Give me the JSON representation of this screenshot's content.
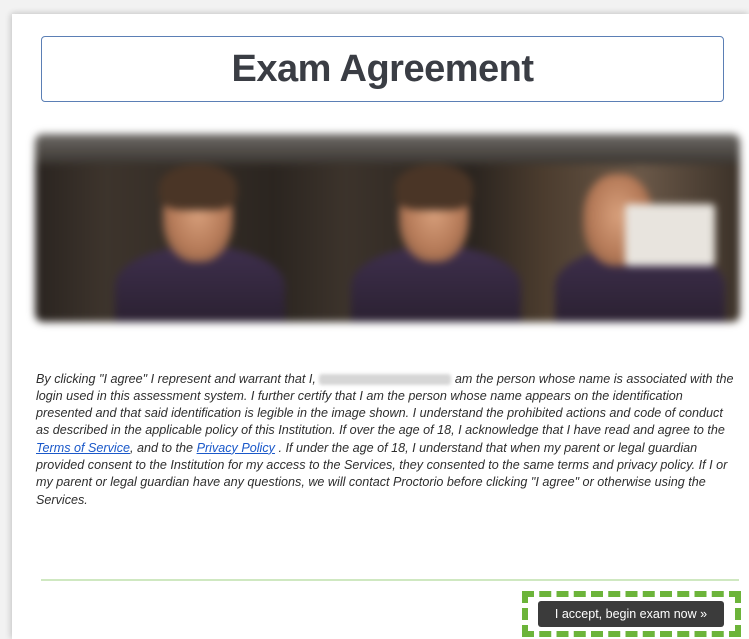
{
  "title": "Exam Agreement",
  "photo": {
    "alt": "blurred identification photo"
  },
  "agreement": {
    "part1": "By clicking \"I agree\" I represent and warrant that I, ",
    "part2": " am the person whose name is associated with the login used in this assessment system. I further certify that I am the person whose name appears on the identification presented and that said identification is legible in the image shown. I understand the prohibited actions and code of conduct as described in the applicable policy of this Institution. If over the age of 18, I acknowledge that I have read and agree to the ",
    "terms_link": "Terms of Service",
    "part3": ", and to the ",
    "privacy_link": "Privacy Policy",
    "part4": " . If under the age of 18, I understand that when my parent or legal guardian provided consent to the Institution for my access to the Services, they consented to the same terms and privacy policy. If I or my parent or legal guardian have any questions, we will contact Proctorio before clicking \"I agree\" or otherwise using the Services."
  },
  "accept_button": "I accept, begin exam now »",
  "colors": {
    "link": "#1a58c9",
    "button_bg": "#3b3b3b",
    "highlight": "#6cb43a",
    "title_border": "#5b7fb5"
  }
}
